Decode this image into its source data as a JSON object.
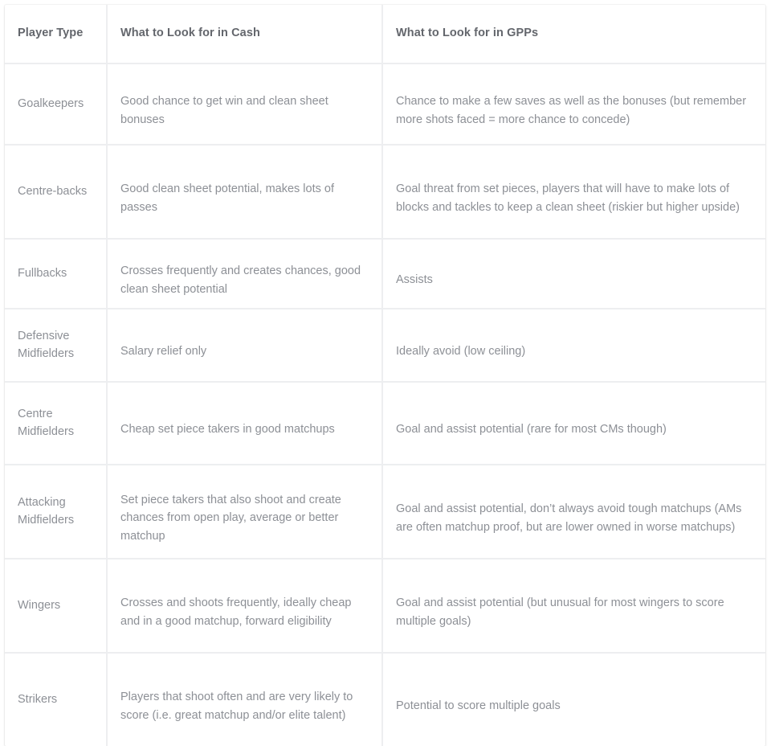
{
  "table": {
    "columns": [
      {
        "key": "player_type",
        "label": "Player Type"
      },
      {
        "key": "cash",
        "label": "What to Look for in Cash"
      },
      {
        "key": "gpp",
        "label": "What to Look for in GPPs"
      }
    ],
    "rows": [
      {
        "player_type": "Goalkeepers",
        "cash": "Good chance to get win and clean sheet bonuses",
        "gpp": "Chance to make a few saves as well as the bonuses (but remember more shots faced = more chance to concede)"
      },
      {
        "player_type": "Centre-backs",
        "cash": "Good clean sheet potential, makes lots of passes",
        "gpp": "Goal threat from set pieces, players that will have to make lots of blocks and tackles to keep a clean sheet (riskier but higher upside)"
      },
      {
        "player_type": "Fullbacks",
        "cash": "Crosses frequently and creates chances, good clean sheet potential",
        "gpp": "Assists"
      },
      {
        "player_type": "Defensive Midfielders",
        "cash": "Salary relief only",
        "gpp": "Ideally avoid (low ceiling)"
      },
      {
        "player_type": "Centre Midfielders",
        "cash": "Cheap set piece takers in good matchups",
        "gpp": "Goal and assist potential (rare for most CMs though)"
      },
      {
        "player_type": "Attacking Midfielders",
        "cash": "Set piece takers that also shoot and create chances from open play, average or better matchup",
        "gpp": "Goal and assist potential, don’t always avoid tough matchups (AMs are often matchup proof, but are lower owned in worse matchups)"
      },
      {
        "player_type": "Wingers",
        "cash": "Crosses and shoots frequently, ideally cheap and in a good matchup, forward eligibility",
        "gpp": "Goal and assist potential (but unusual for most wingers to score multiple goals)"
      },
      {
        "player_type": "Strikers",
        "cash": "Players that shoot often and are very likely to score (i.e. great matchup and/or elite talent)",
        "gpp": "Potential to score multiple goals"
      }
    ]
  },
  "colors": {
    "header_text": "#63666c",
    "body_text": "#8d9096",
    "border": "#edeef0",
    "background": "#ffffff"
  }
}
